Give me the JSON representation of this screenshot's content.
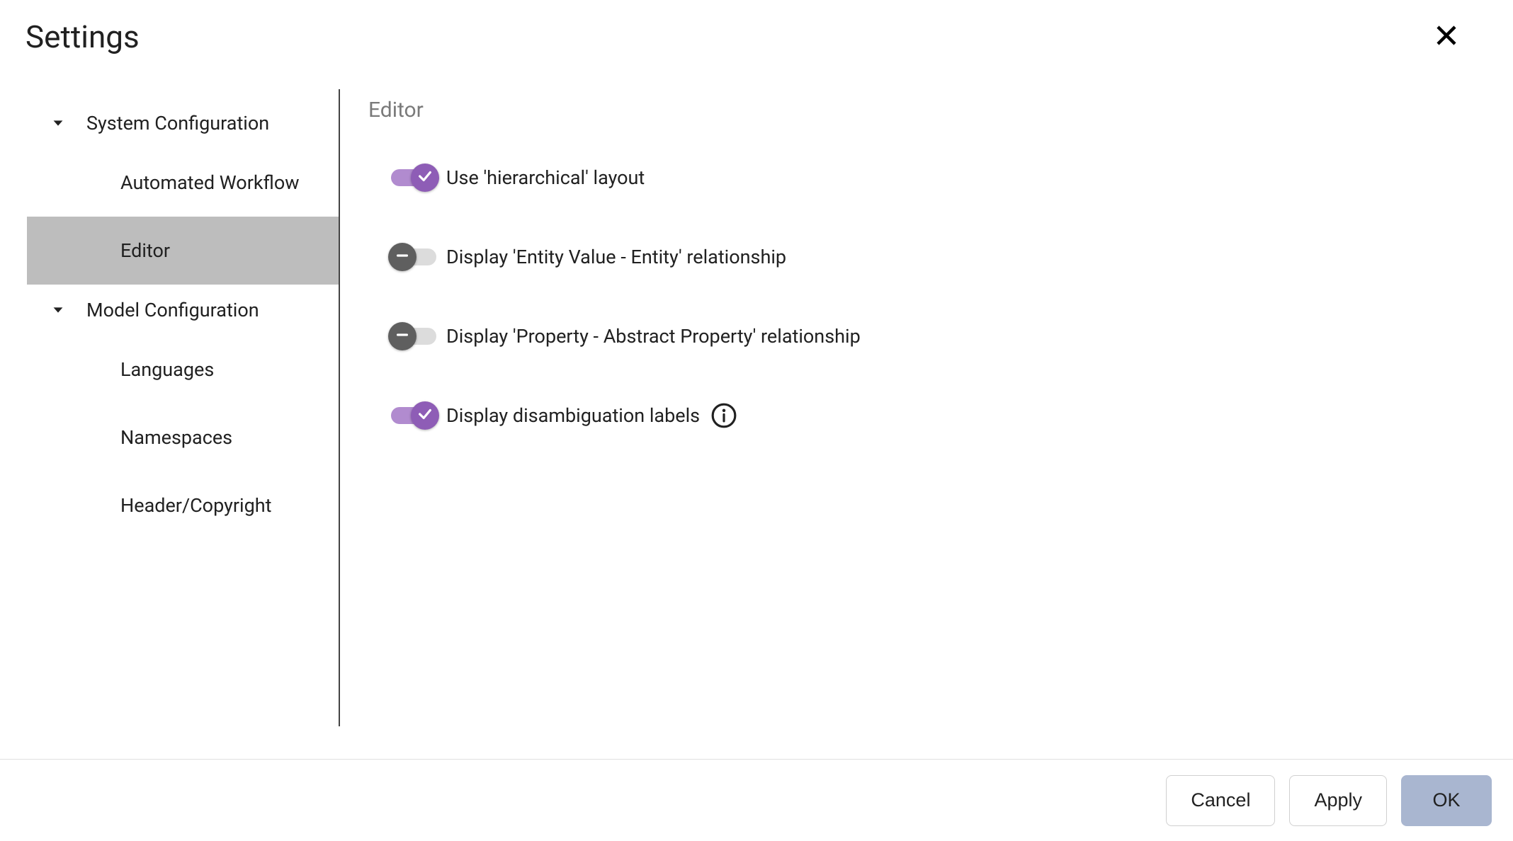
{
  "title": "Settings",
  "sidebar": {
    "groups": [
      {
        "label": "System Configuration",
        "items": [
          {
            "label": "Automated Workflow",
            "selected": false
          },
          {
            "label": "Editor",
            "selected": true
          }
        ]
      },
      {
        "label": "Model Configuration",
        "items": [
          {
            "label": "Languages",
            "selected": false
          },
          {
            "label": "Namespaces",
            "selected": false
          },
          {
            "label": "Header/Copyright",
            "selected": false
          }
        ]
      }
    ]
  },
  "content": {
    "title": "Editor",
    "toggles": [
      {
        "label": "Use 'hierarchical' layout",
        "on": true,
        "info": false
      },
      {
        "label": "Display 'Entity Value - Entity' relationship",
        "on": false,
        "info": false
      },
      {
        "label": "Display 'Property - Abstract Property' relationship",
        "on": false,
        "info": false
      },
      {
        "label": "Display disambiguation labels",
        "on": true,
        "info": true
      }
    ]
  },
  "footer": {
    "cancel": "Cancel",
    "apply": "Apply",
    "ok": "OK"
  }
}
